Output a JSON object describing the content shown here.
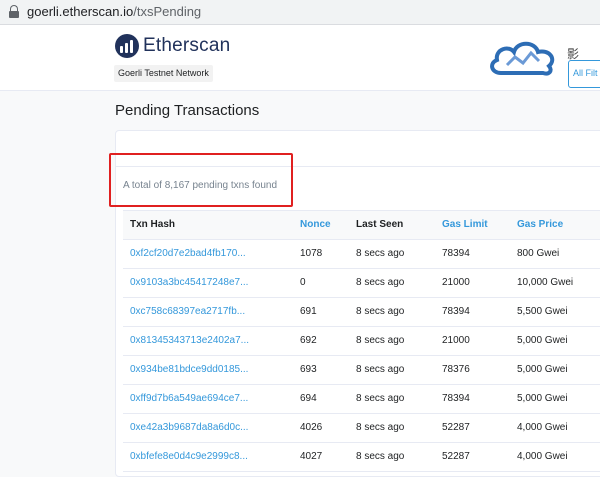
{
  "browser": {
    "url_domain": "goerli.etherscan.io",
    "url_path": "/txsPending"
  },
  "header": {
    "logo_text": "Etherscan",
    "network_badge": "Goerli Testnet Network",
    "watermark_text": "影",
    "account_partial": "All Filt"
  },
  "page": {
    "title": "Pending Transactions",
    "total_text": "A total of 8,167 pending txns found"
  },
  "colors": {
    "brand": "#21325b",
    "link": "#3498db",
    "highlight": "#e02020"
  },
  "table": {
    "headers": [
      "Txn Hash",
      "Nonce",
      "Last Seen",
      "Gas Limit",
      "Gas Price"
    ],
    "rows": [
      {
        "hash": "0xf2cf20d7e2bad4fb170...",
        "nonce": "1078",
        "last_seen": "8 secs ago",
        "gas_limit": "78394",
        "gas_price": "800 Gwei"
      },
      {
        "hash": "0x9103a3bc45417248e7...",
        "nonce": "0",
        "last_seen": "8 secs ago",
        "gas_limit": "21000",
        "gas_price": "10,000 Gwei"
      },
      {
        "hash": "0xc758c68397ea2717fb...",
        "nonce": "691",
        "last_seen": "8 secs ago",
        "gas_limit": "78394",
        "gas_price": "5,500 Gwei"
      },
      {
        "hash": "0x81345343713e2402a7...",
        "nonce": "692",
        "last_seen": "8 secs ago",
        "gas_limit": "21000",
        "gas_price": "5,000 Gwei"
      },
      {
        "hash": "0x934be81bdce9dd0185...",
        "nonce": "693",
        "last_seen": "8 secs ago",
        "gas_limit": "78376",
        "gas_price": "5,000 Gwei"
      },
      {
        "hash": "0xff9d7b6a549ae694ce7...",
        "nonce": "694",
        "last_seen": "8 secs ago",
        "gas_limit": "78394",
        "gas_price": "5,000 Gwei"
      },
      {
        "hash": "0xe42a3b9687da8a6d0c...",
        "nonce": "4026",
        "last_seen": "8 secs ago",
        "gas_limit": "52287",
        "gas_price": "4,000 Gwei"
      },
      {
        "hash": "0xbfefe8e0d4c9e2999c8...",
        "nonce": "4027",
        "last_seen": "8 secs ago",
        "gas_limit": "52287",
        "gas_price": "4,000 Gwei"
      }
    ]
  }
}
